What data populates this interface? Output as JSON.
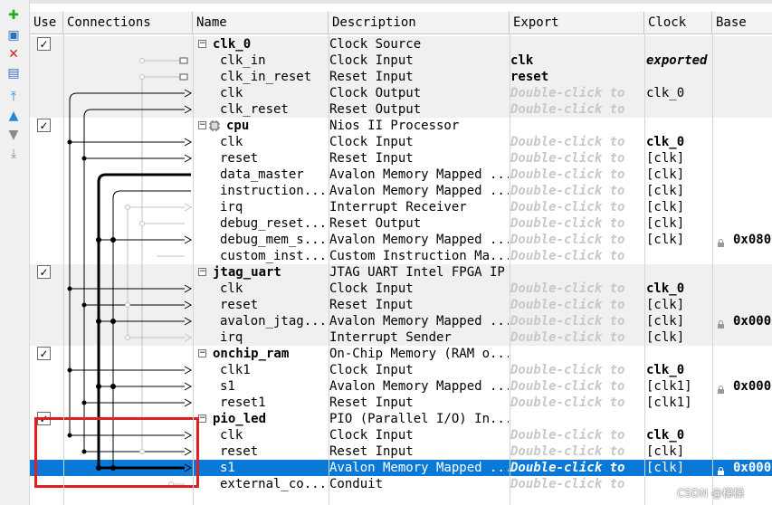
{
  "toolbar": {
    "buttons": [
      {
        "icon": "add-icon",
        "glyph": "✚",
        "color": "#22aa22"
      },
      {
        "icon": "connect-icon",
        "glyph": "▣",
        "color": "#2a6fc0"
      },
      {
        "icon": "remove-icon",
        "glyph": "✕",
        "color": "#d02020"
      },
      {
        "icon": "edit-icon",
        "glyph": "▤",
        "color": "#3a70c8"
      },
      {
        "icon": "move-top-icon",
        "glyph": "⤒",
        "color": "#1e88e5"
      },
      {
        "icon": "move-up-icon",
        "glyph": "▲",
        "color": "#1e88e5"
      },
      {
        "icon": "move-down-icon",
        "glyph": "▼",
        "color": "#8a8a8a"
      },
      {
        "icon": "move-bottom-icon",
        "glyph": "⤓",
        "color": "#8a8a8a"
      }
    ]
  },
  "columns": {
    "use": "Use",
    "connections": "Connections",
    "name": "Name",
    "description": "Description",
    "export": "Export",
    "clock": "Clock",
    "base": "Base"
  },
  "colors": {
    "selected_row": "#0a78d7",
    "shaded_row": "#f0f0f0",
    "highlight_box": "#e02020",
    "double_click_text": "#c8c8c8"
  },
  "rows": [
    {
      "type": "module",
      "checked": true,
      "name": "clk_0",
      "description": "Clock Source",
      "export": "",
      "clock": "",
      "base": ""
    },
    {
      "type": "port",
      "name": "clk_in",
      "description": "Clock Input",
      "export": "clk",
      "clock": "exported",
      "base": ""
    },
    {
      "type": "port",
      "name": "clk_in_reset",
      "description": "Reset Input",
      "export": "reset",
      "clock": "",
      "base": ""
    },
    {
      "type": "port",
      "name": "clk",
      "description": "Clock Output",
      "export": "Double-click to",
      "clock": "clk_0",
      "base": ""
    },
    {
      "type": "port",
      "name": "clk_reset",
      "description": "Reset Output",
      "export": "Double-click to",
      "clock": "",
      "base": ""
    },
    {
      "type": "module",
      "checked": true,
      "name": "cpu",
      "description": "Nios II Processor",
      "export": "",
      "clock": "",
      "base": ""
    },
    {
      "type": "port",
      "name": "clk",
      "description": "Clock Input",
      "export": "Double-click to",
      "clock": "clk_0",
      "base": ""
    },
    {
      "type": "port",
      "name": "reset",
      "description": "Reset Input",
      "export": "Double-click to",
      "clock": "[clk]",
      "base": ""
    },
    {
      "type": "port",
      "name": "data_master",
      "description": "Avalon Memory Mapped ...",
      "export": "Double-click to",
      "clock": "[clk]",
      "base": ""
    },
    {
      "type": "port",
      "name": "instruction...",
      "description": "Avalon Memory Mapped ...",
      "export": "Double-click to",
      "clock": "[clk]",
      "base": ""
    },
    {
      "type": "port",
      "name": "irq",
      "description": "Interrupt Receiver",
      "export": "Double-click to",
      "clock": "[clk]",
      "base": ""
    },
    {
      "type": "port",
      "name": "debug_reset...",
      "description": "Reset Output",
      "export": "Double-click to",
      "clock": "[clk]",
      "base": ""
    },
    {
      "type": "port",
      "name": "debug_mem_s...",
      "description": "Avalon Memory Mapped ...",
      "export": "Double-click to",
      "clock": "[clk]",
      "base": "0x080"
    },
    {
      "type": "port",
      "name": "custom_inst...",
      "description": "Custom Instruction Ma...",
      "export": "Double-click to",
      "clock": "",
      "base": ""
    },
    {
      "type": "module",
      "checked": true,
      "name": "jtag_uart",
      "description": "JTAG UART Intel FPGA IP",
      "export": "",
      "clock": "",
      "base": ""
    },
    {
      "type": "port",
      "name": "clk",
      "description": "Clock Input",
      "export": "Double-click to",
      "clock": "clk_0",
      "base": ""
    },
    {
      "type": "port",
      "name": "reset",
      "description": "Reset Input",
      "export": "Double-click to",
      "clock": "[clk]",
      "base": ""
    },
    {
      "type": "port",
      "name": "avalon_jtag...",
      "description": "Avalon Memory Mapped ...",
      "export": "Double-click to",
      "clock": "[clk]",
      "base": "0x000"
    },
    {
      "type": "port",
      "name": "irq",
      "description": "Interrupt Sender",
      "export": "Double-click to",
      "clock": "[clk]",
      "base": ""
    },
    {
      "type": "module",
      "checked": true,
      "name": "onchip_ram",
      "description": "On-Chip Memory (RAM o...",
      "export": "",
      "clock": "",
      "base": ""
    },
    {
      "type": "port",
      "name": "clk1",
      "description": "Clock Input",
      "export": "Double-click to",
      "clock": "clk_0",
      "base": ""
    },
    {
      "type": "port",
      "name": "s1",
      "description": "Avalon Memory Mapped ...",
      "export": "Double-click to",
      "clock": "[clk1]",
      "base": "0x000"
    },
    {
      "type": "port",
      "name": "reset1",
      "description": "Reset Input",
      "export": "Double-click to",
      "clock": "[clk1]",
      "base": ""
    },
    {
      "type": "module",
      "checked": true,
      "name": "pio_led",
      "description": "PIO (Parallel I/O) In...",
      "export": "",
      "clock": "",
      "base": ""
    },
    {
      "type": "port",
      "name": "clk",
      "description": "Clock Input",
      "export": "Double-click to",
      "clock": "clk_0",
      "base": ""
    },
    {
      "type": "port",
      "name": "reset",
      "description": "Reset Input",
      "export": "Double-click to",
      "clock": "[clk]",
      "base": ""
    },
    {
      "type": "port",
      "name": "s1",
      "description": "Avalon Memory Mapped ...",
      "export": "Double-click to",
      "clock": "[clk]",
      "base": "0x000",
      "selected": true
    },
    {
      "type": "port",
      "name": "external_co...",
      "description": "Conduit",
      "export": "Double-click to",
      "clock": "",
      "base": ""
    }
  ],
  "watermark": "CSDN @梯梯"
}
